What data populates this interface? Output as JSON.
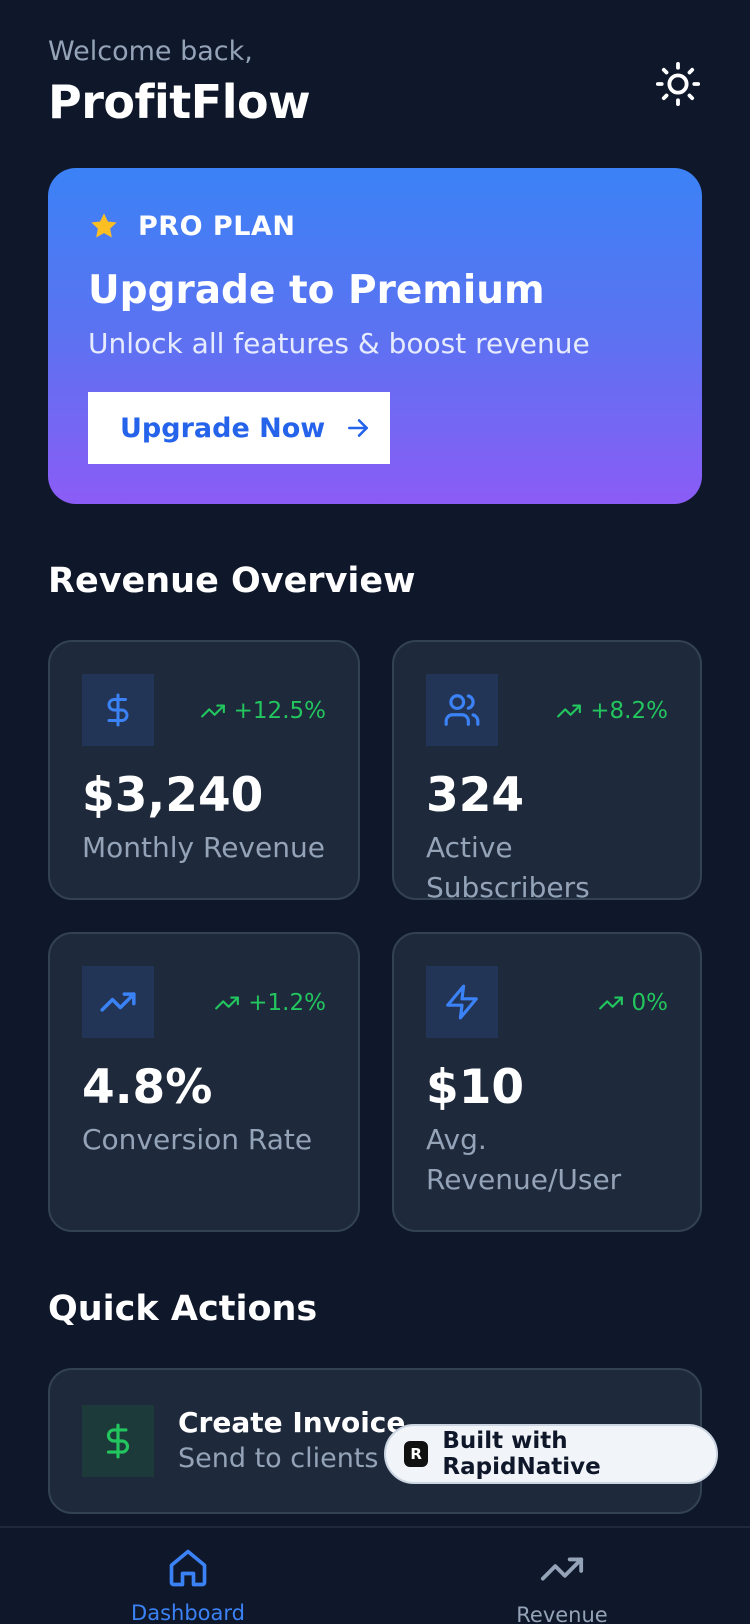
{
  "header": {
    "welcome": "Welcome back,",
    "title": "ProfitFlow",
    "theme_icon": "sun-icon"
  },
  "promo": {
    "badge": "PRO PLAN",
    "title": "Upgrade to Premium",
    "subtitle": "Unlock all features & boost revenue",
    "button_label": "Upgrade Now",
    "gradient_top": "#3b82f6",
    "gradient_bottom": "#8b5cf6"
  },
  "overview": {
    "title": "Revenue Overview",
    "cards": [
      {
        "icon": "dollar-icon",
        "trend": "+12.5%",
        "value": "$3,240",
        "label": "Monthly Revenue"
      },
      {
        "icon": "users-icon",
        "trend": "+8.2%",
        "value": "324",
        "label": "Active Subscribers"
      },
      {
        "icon": "trending-up-icon",
        "trend": "+1.2%",
        "value": "4.8%",
        "label": "Conversion Rate"
      },
      {
        "icon": "lightning-icon",
        "trend": "0%",
        "value": "$10",
        "label": "Avg. Revenue/User"
      }
    ]
  },
  "quick_actions": {
    "title": "Quick Actions",
    "items": [
      {
        "icon": "dollar-icon",
        "title": "Create Invoice",
        "subtitle": "Send to clients i"
      }
    ]
  },
  "badge": {
    "text": "Built with RapidNative",
    "logo_letter": "R"
  },
  "tabbar": {
    "tabs": [
      {
        "label": "Dashboard",
        "icon": "home-icon",
        "active": true
      },
      {
        "label": "Revenue",
        "icon": "trending-up-icon",
        "active": false
      }
    ]
  },
  "colors": {
    "background": "#0f172a",
    "card": "#1e293b",
    "accent": "#3b82f6",
    "positive": "#22c55e",
    "muted": "#94a3b8"
  }
}
